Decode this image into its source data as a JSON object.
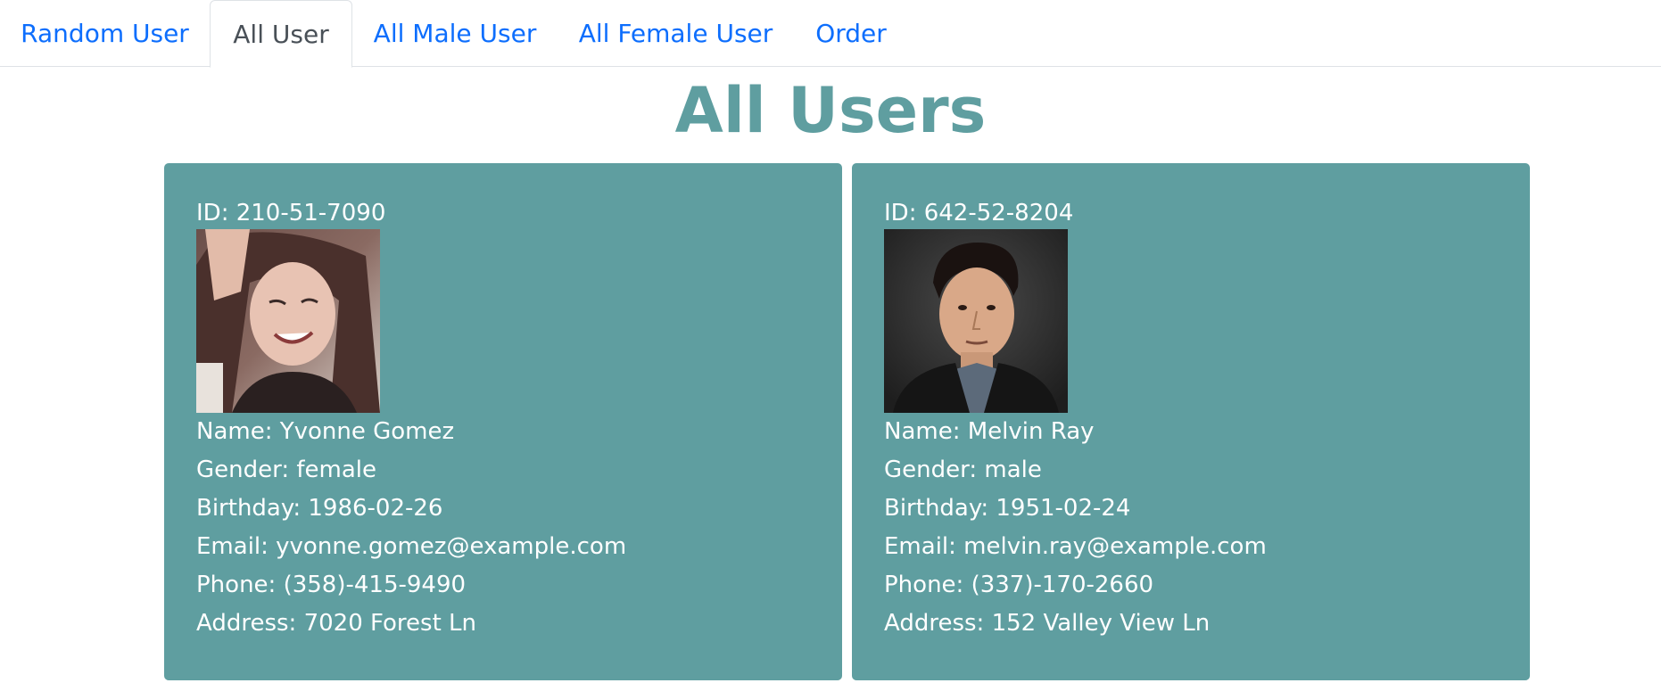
{
  "nav": {
    "tabs": [
      {
        "label": "Random User",
        "active": false
      },
      {
        "label": "All User",
        "active": true
      },
      {
        "label": "All Male User",
        "active": false
      },
      {
        "label": "All Female User",
        "active": false
      },
      {
        "label": "Order",
        "active": false
      }
    ]
  },
  "page": {
    "title": "All Users"
  },
  "users": [
    {
      "id": "ID: 210-51-7090",
      "name": "Name: Yvonne Gomez",
      "gender": "Gender: female",
      "birthday": "Birthday: 1986-02-26",
      "email": "Email: yvonne.gomez@example.com",
      "phone": "Phone: (358)-415-9490",
      "address": "Address: 7020 Forest Ln",
      "photo_alt": "female-user-photo"
    },
    {
      "id": "ID: 642-52-8204",
      "name": "Name: Melvin Ray",
      "gender": "Gender: male",
      "birthday": "Birthday: 1951-02-24",
      "email": "Email: melvin.ray@example.com",
      "phone": "Phone: (337)-170-2660",
      "address": "Address: 152 Valley View Ln",
      "photo_alt": "male-user-photo"
    }
  ],
  "colors": {
    "card_bg": "#5f9ea0",
    "title": "#5f9ea0",
    "link": "#0d6efd",
    "active_tab_text": "#495057"
  }
}
